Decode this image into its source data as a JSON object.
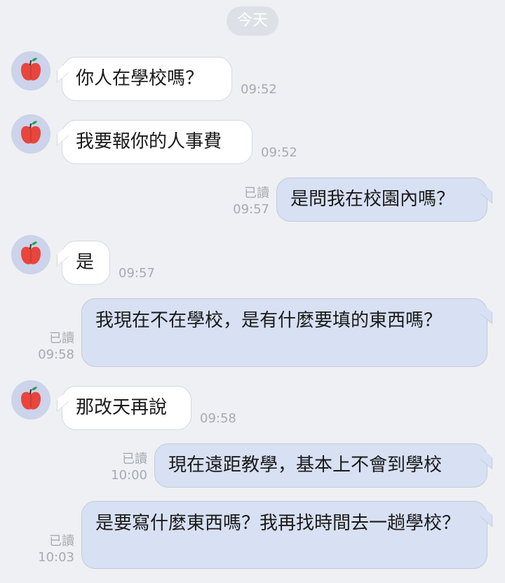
{
  "date_separator": "今天",
  "contact": {
    "avatar_icon": "apple-icon",
    "avatar_bg": "#ccd3ea",
    "apple_color": "#e8453c",
    "leaf_color": "#2e9e4f"
  },
  "colors": {
    "background": "#eef0f3",
    "incoming_bubble": "#ffffff",
    "outgoing_bubble": "#d8e0f3",
    "meta_text": "#a6aab2"
  },
  "messages": [
    {
      "direction": "in",
      "text": "你人在學校嗎？",
      "time": "09:52"
    },
    {
      "direction": "in",
      "text": "我要報你的人事費",
      "time": "09:52"
    },
    {
      "direction": "out",
      "text": "是問我在校園內嗎？",
      "status": "已讀",
      "time": "09:57"
    },
    {
      "direction": "in",
      "text": "是",
      "time": "09:57"
    },
    {
      "direction": "out",
      "text": "我現在不在學校，是有什麼要填的東西嗎？",
      "status": "已讀",
      "time": "09:58"
    },
    {
      "direction": "in",
      "text": "那改天再說",
      "time": "09:58"
    },
    {
      "direction": "out",
      "text": "現在遠距教學，基本上不會到學校",
      "status": "已讀",
      "time": "10:00"
    },
    {
      "direction": "out",
      "text": "是要寫什麼東西嗎？我再找時間去一趟學校？",
      "status": "已讀",
      "time": "10:03"
    }
  ]
}
